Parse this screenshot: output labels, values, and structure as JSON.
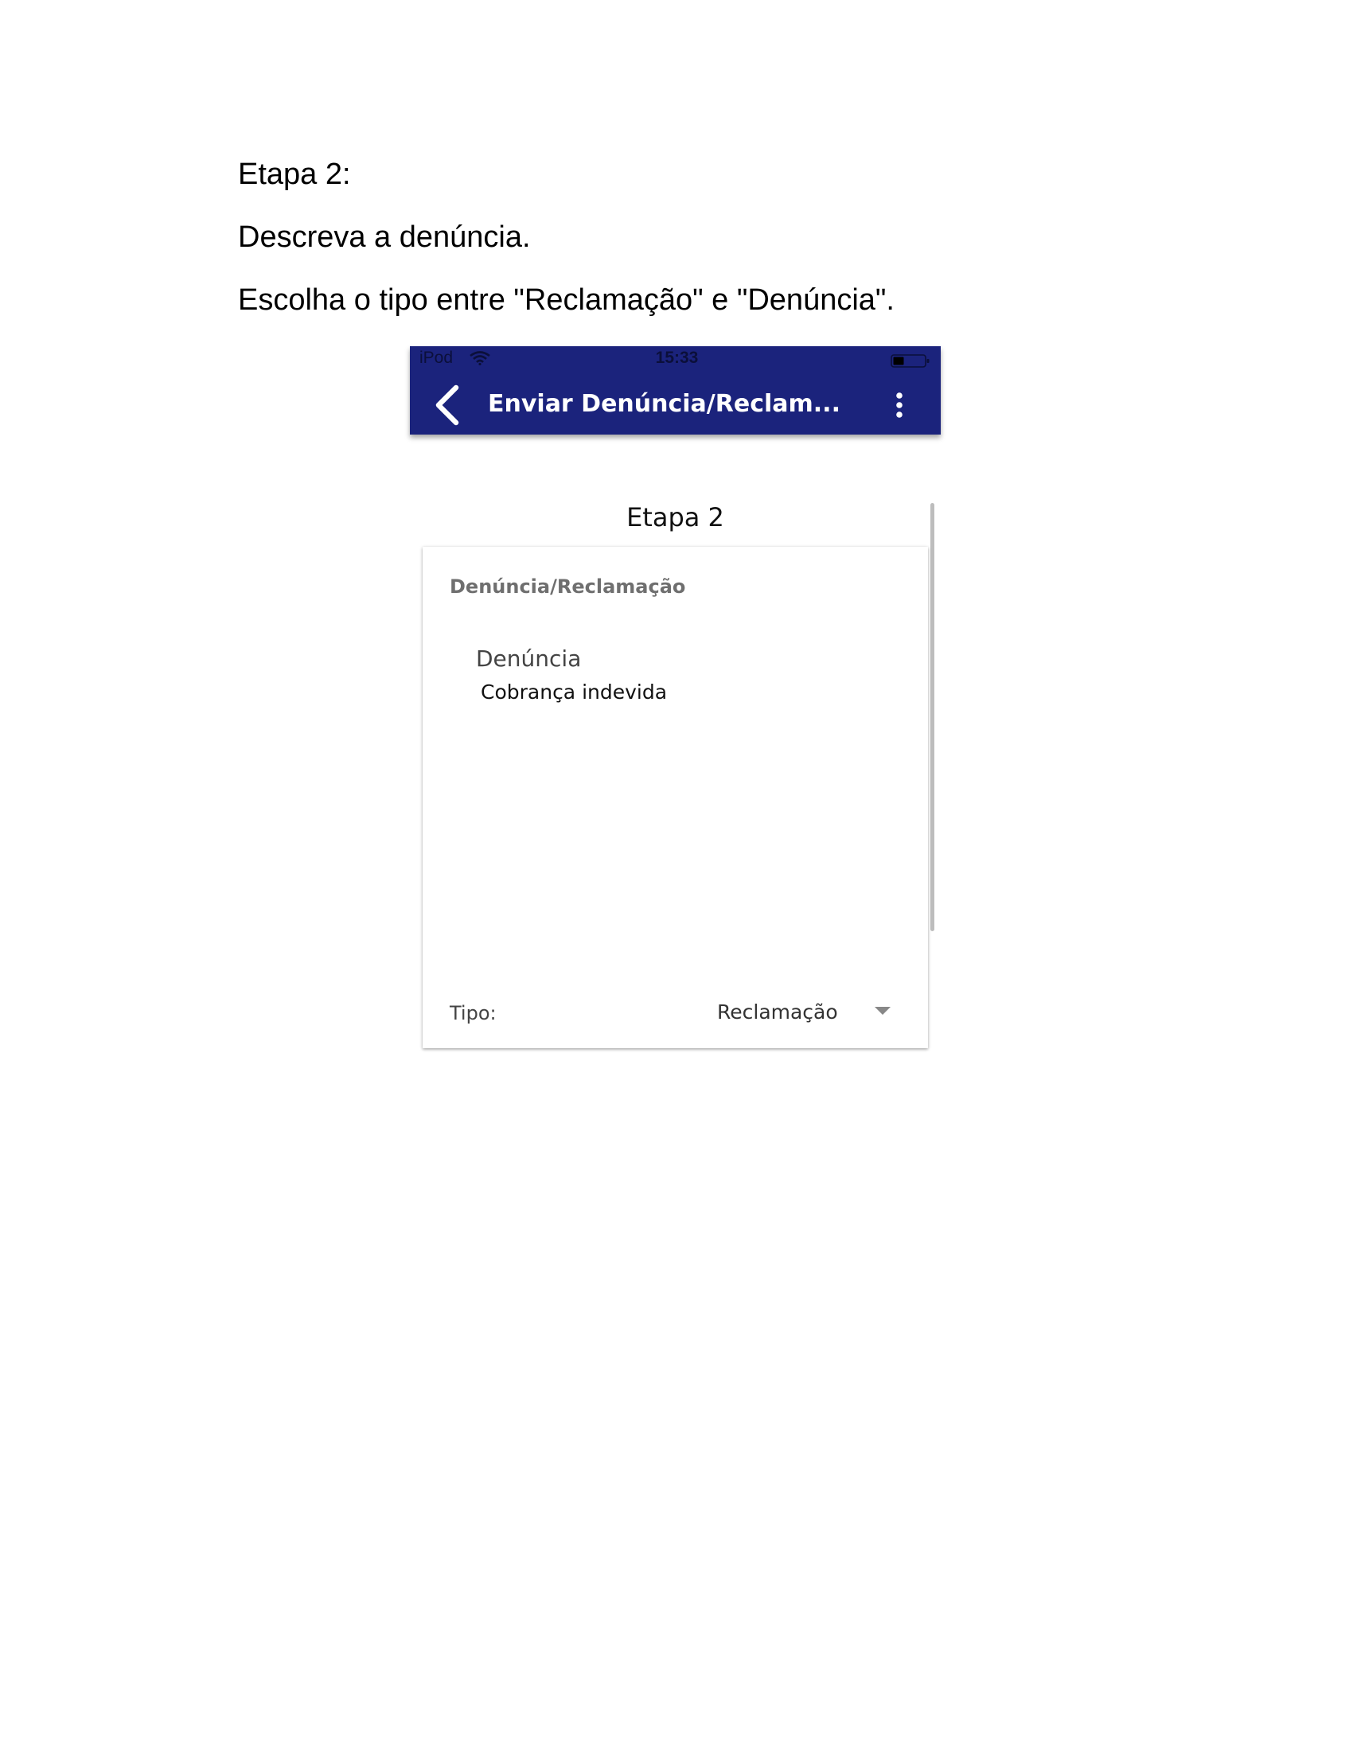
{
  "document": {
    "lines": [
      "Etapa 2:",
      "Descreva a denúncia.",
      "Escolha o tipo entre \"Reclamação\" e \"Denúncia\"."
    ]
  },
  "phone": {
    "status_bar": {
      "carrier": "iPod",
      "time": "15:33",
      "icons": [
        "wifi-icon",
        "battery-icon"
      ]
    },
    "app_bar": {
      "title": "Enviar Denúncia/Reclam...",
      "back_icon": "chevron-left-icon",
      "menu_icon": "more-vertical-icon",
      "background": "#1b237c"
    },
    "step_title": "Etapa 2",
    "card": {
      "header": "Denúncia/Reclamação",
      "field_label": "Denúncia",
      "field_value": "Cobrança indevida",
      "tipo_label": "Tipo:",
      "tipo_value": "Reclamação",
      "tipo_icon": "dropdown-arrow-icon"
    }
  }
}
